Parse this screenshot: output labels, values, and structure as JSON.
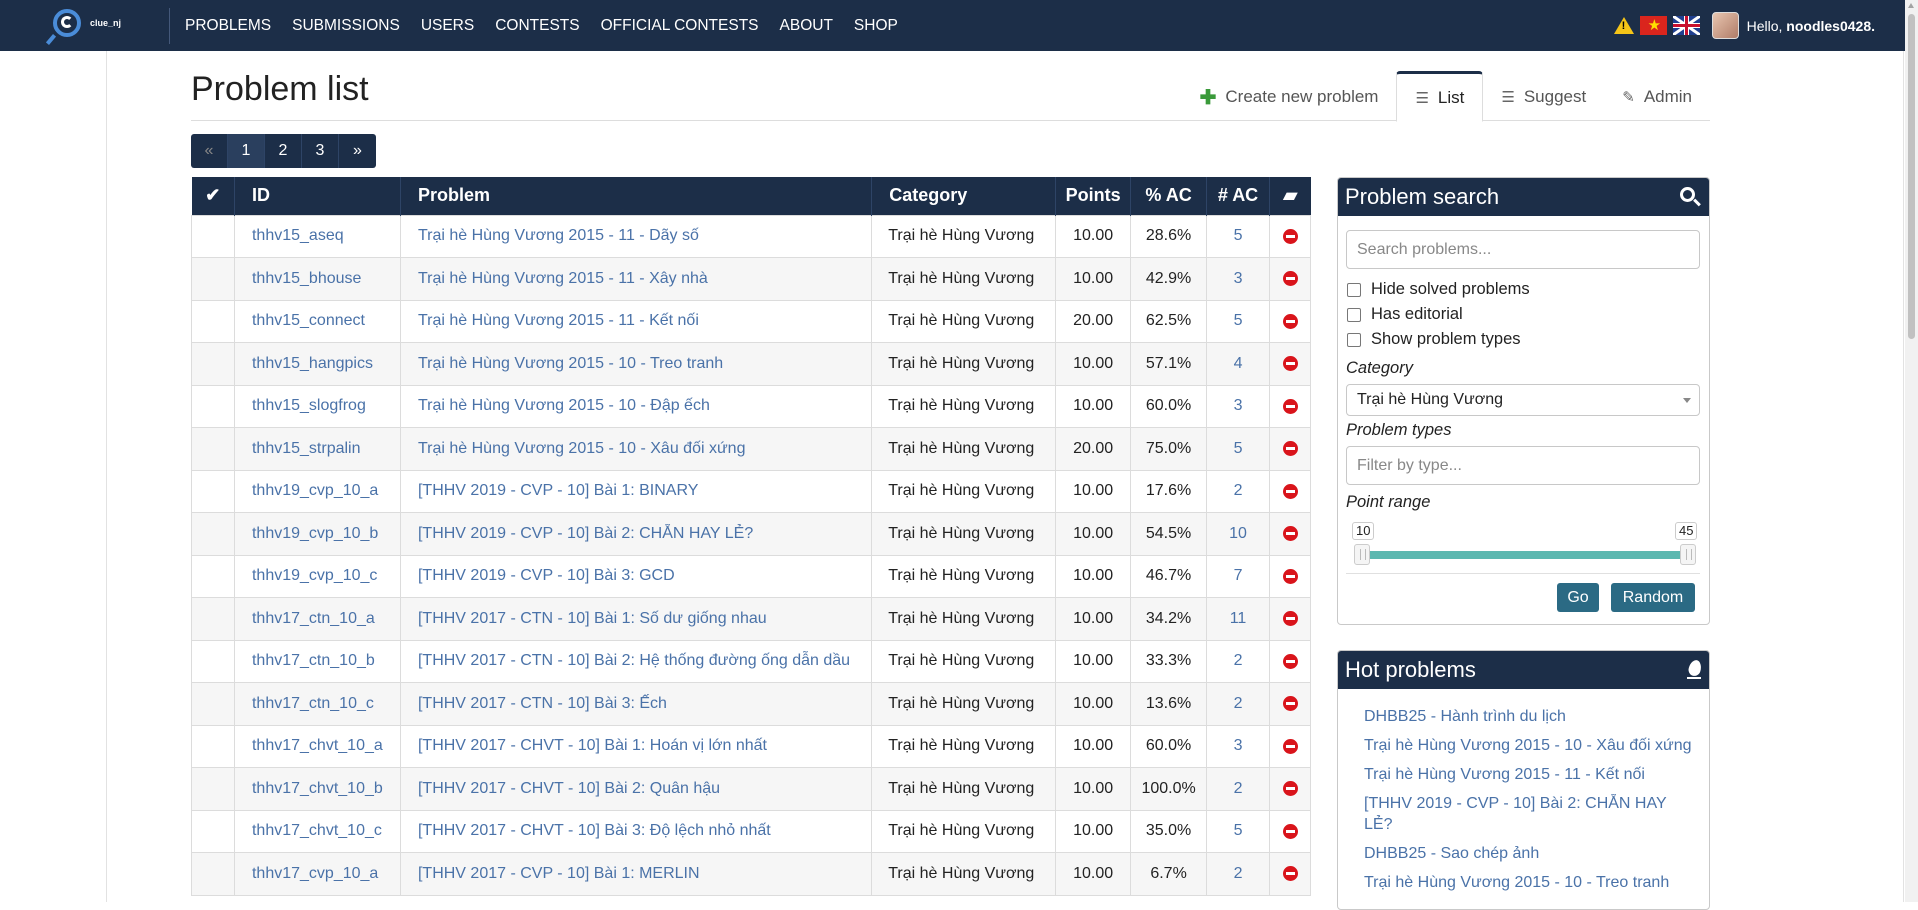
{
  "nav": {
    "logo_text": "clue_nj",
    "links": [
      "PROBLEMS",
      "SUBMISSIONS",
      "USERS",
      "CONTESTS",
      "OFFICIAL CONTESTS",
      "ABOUT",
      "SHOP"
    ],
    "hello_prefix": "Hello,",
    "username": "noodles0428."
  },
  "page": {
    "title": "Problem list",
    "tabs": [
      {
        "label": "Create new problem",
        "icon": "plus-icon"
      },
      {
        "label": "List",
        "icon": "list-icon",
        "active": true
      },
      {
        "label": "Suggest",
        "icon": "list-icon"
      },
      {
        "label": "Admin",
        "icon": "edit-icon"
      }
    ]
  },
  "pagination": {
    "prev": "«",
    "pages": [
      "1",
      "2",
      "3"
    ],
    "current": "1",
    "next": "»"
  },
  "table": {
    "headers": {
      "check": "✔",
      "id": "ID",
      "problem": "Problem",
      "category": "Category",
      "points": "Points",
      "pct_ac": "% AC",
      "num_ac": "# AC",
      "book": "book-icon"
    },
    "rows": [
      {
        "id": "thhv15_aseq",
        "problem": "Trại hè Hùng Vương 2015 - 11 - Dãy số",
        "category": "Trại hè Hùng Vương",
        "points": "10.00",
        "pct_ac": "28.6%",
        "num_ac": "5"
      },
      {
        "id": "thhv15_bhouse",
        "problem": "Trại hè Hùng Vương 2015 - 11 - Xây nhà",
        "category": "Trại hè Hùng Vương",
        "points": "10.00",
        "pct_ac": "42.9%",
        "num_ac": "3"
      },
      {
        "id": "thhv15_connect",
        "problem": "Trại hè Hùng Vương 2015 - 11 - Kết nối",
        "category": "Trại hè Hùng Vương",
        "points": "20.00",
        "pct_ac": "62.5%",
        "num_ac": "5"
      },
      {
        "id": "thhv15_hangpics",
        "problem": "Trại hè Hùng Vương 2015 - 10 - Treo tranh",
        "category": "Trại hè Hùng Vương",
        "points": "10.00",
        "pct_ac": "57.1%",
        "num_ac": "4"
      },
      {
        "id": "thhv15_slogfrog",
        "problem": "Trại hè Hùng Vương 2015 - 10 - Đập ếch",
        "category": "Trại hè Hùng Vương",
        "points": "10.00",
        "pct_ac": "60.0%",
        "num_ac": "3"
      },
      {
        "id": "thhv15_strpalin",
        "problem": "Trại hè Hùng Vương 2015 - 10 - Xâu đối xứng",
        "category": "Trại hè Hùng Vương",
        "points": "20.00",
        "pct_ac": "75.0%",
        "num_ac": "5"
      },
      {
        "id": "thhv19_cvp_10_a",
        "problem": "[THHV 2019 - CVP - 10] Bài 1: BINARY",
        "category": "Trại hè Hùng Vương",
        "points": "10.00",
        "pct_ac": "17.6%",
        "num_ac": "2"
      },
      {
        "id": "thhv19_cvp_10_b",
        "problem": "[THHV 2019 - CVP - 10] Bài 2: CHẴN HAY LẺ?",
        "category": "Trại hè Hùng Vương",
        "points": "10.00",
        "pct_ac": "54.5%",
        "num_ac": "10"
      },
      {
        "id": "thhv19_cvp_10_c",
        "problem": "[THHV 2019 - CVP - 10] Bài 3: GCD",
        "category": "Trại hè Hùng Vương",
        "points": "10.00",
        "pct_ac": "46.7%",
        "num_ac": "7"
      },
      {
        "id": "thhv17_ctn_10_a",
        "problem": "[THHV 2017 - CTN - 10] Bài 1: Số dư giống nhau",
        "category": "Trại hè Hùng Vương",
        "points": "10.00",
        "pct_ac": "34.2%",
        "num_ac": "11"
      },
      {
        "id": "thhv17_ctn_10_b",
        "problem": "[THHV 2017 - CTN - 10] Bài 2: Hệ thống đường ống dẫn dầu",
        "category": "Trại hè Hùng Vương",
        "points": "10.00",
        "pct_ac": "33.3%",
        "num_ac": "2"
      },
      {
        "id": "thhv17_ctn_10_c",
        "problem": "[THHV 2017 - CTN - 10] Bài 3: Ếch",
        "category": "Trại hè Hùng Vương",
        "points": "10.00",
        "pct_ac": "13.6%",
        "num_ac": "2"
      },
      {
        "id": "thhv17_chvt_10_a",
        "problem": "[THHV 2017 - CHVT - 10] Bài 1: Hoán vị lớn nhất",
        "category": "Trại hè Hùng Vương",
        "points": "10.00",
        "pct_ac": "60.0%",
        "num_ac": "3"
      },
      {
        "id": "thhv17_chvt_10_b",
        "problem": "[THHV 2017 - CHVT - 10] Bài 2: Quân hậu",
        "category": "Trại hè Hùng Vương",
        "points": "10.00",
        "pct_ac": "100.0%",
        "num_ac": "2"
      },
      {
        "id": "thhv17_chvt_10_c",
        "problem": "[THHV 2017 - CHVT - 10] Bài 3: Độ lệch nhỏ nhất",
        "category": "Trại hè Hùng Vương",
        "points": "10.00",
        "pct_ac": "35.0%",
        "num_ac": "5"
      },
      {
        "id": "thhv17_cvp_10_a",
        "problem": "[THHV 2017 - CVP - 10] Bài 1: MERLIN",
        "category": "Trại hè Hùng Vương",
        "points": "10.00",
        "pct_ac": "6.7%",
        "num_ac": "2"
      }
    ]
  },
  "search": {
    "title": "Problem search",
    "placeholder": "Search problems...",
    "hide_solved": "Hide solved problems",
    "has_editorial": "Has editorial",
    "show_types": "Show problem types",
    "category_label": "Category",
    "category_value": "Trại hè Hùng Vương",
    "types_label": "Problem types",
    "types_placeholder": "Filter by type...",
    "range_label": "Point range",
    "range_min": "10",
    "range_max": "45",
    "go": "Go",
    "random": "Random"
  },
  "hot": {
    "title": "Hot problems",
    "items": [
      "DHBB25 - Hành trình du lịch",
      "Trại hè Hùng Vương 2015 - 10 - Xâu đối xứng",
      "Trại hè Hùng Vương 2015 - 11 - Kết nối",
      "[THHV 2019 - CVP - 10] Bài 2: CHẴN HAY LẺ?",
      "DHBB25 - Sao chép ảnh",
      "Trại hè Hùng Vương 2015 - 10 - Treo tranh"
    ]
  },
  "colors": {
    "navbar": "#1c2e48",
    "link": "#4a72a8",
    "button": "#2b6a84",
    "slider": "#5cb8b0",
    "unsolved": "#d9141b"
  }
}
